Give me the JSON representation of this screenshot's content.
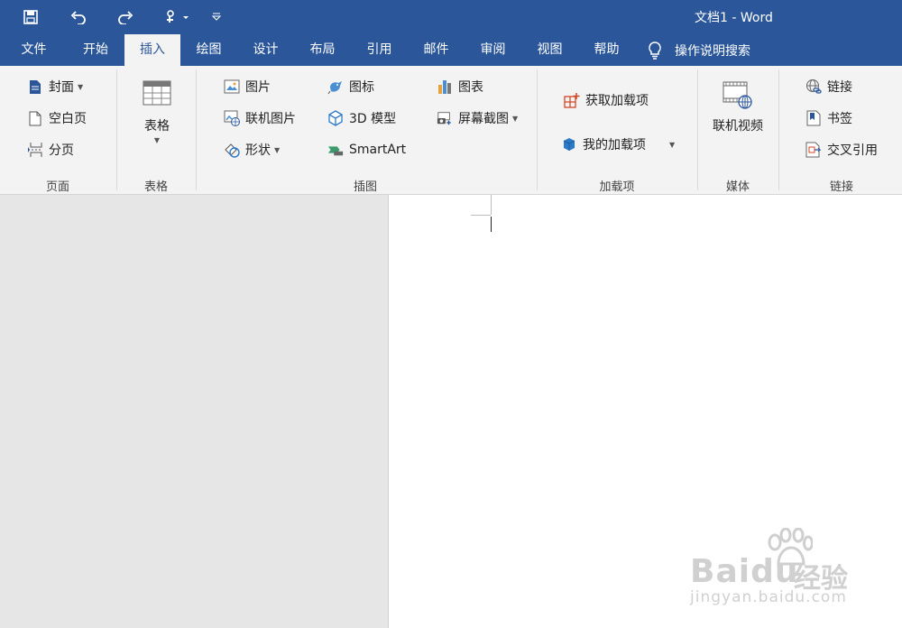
{
  "window": {
    "title": "文档1  -  Word"
  },
  "qat": {
    "save": "save-icon",
    "undo": "undo-icon",
    "redo": "redo-icon",
    "touch": "touch-mode-icon",
    "customize": "customize-qat-icon"
  },
  "tabs": [
    {
      "label": "文件"
    },
    {
      "label": "开始"
    },
    {
      "label": "插入"
    },
    {
      "label": "绘图"
    },
    {
      "label": "设计"
    },
    {
      "label": "布局"
    },
    {
      "label": "引用"
    },
    {
      "label": "邮件"
    },
    {
      "label": "审阅"
    },
    {
      "label": "视图"
    },
    {
      "label": "帮助"
    }
  ],
  "active_tab": "插入",
  "tell_me": {
    "label": "操作说明搜索"
  },
  "groups": {
    "pages": {
      "label": "页面",
      "cover": "封面",
      "blank": "空白页",
      "break": "分页"
    },
    "tables": {
      "label": "表格",
      "table": "表格"
    },
    "illustrations": {
      "label": "插图",
      "picture": "图片",
      "online_picture": "联机图片",
      "shapes": "形状",
      "icons": "图标",
      "model3d": "3D 模型",
      "smartart": "SmartArt",
      "chart": "图表",
      "screenshot": "屏幕截图"
    },
    "addins": {
      "label": "加载项",
      "get": "获取加载项",
      "mine": "我的加载项"
    },
    "media": {
      "label": "媒体",
      "video": "联机视频"
    },
    "links": {
      "label": "链接",
      "link": "链接",
      "bookmark": "书签",
      "crossref": "交叉引用"
    }
  },
  "watermark": {
    "brand": "Baidu",
    "sub": "经验",
    "url": "jingyan.baidu.com"
  },
  "colors": {
    "titlebar": "#2b579a",
    "ribbon": "#f3f3f3",
    "accent_orange": "#d24726"
  }
}
